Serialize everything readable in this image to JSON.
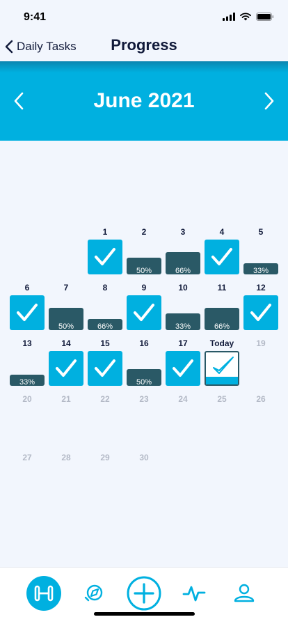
{
  "status": {
    "time": "9:41"
  },
  "nav": {
    "back_label": "Daily Tasks",
    "title": "Progress"
  },
  "month": {
    "title": "June 2021"
  },
  "colors": {
    "accent": "#00b0e0",
    "partial": "#2a5966",
    "future_text": "#b3b9c6",
    "background": "#f2f6fd"
  },
  "calendar": {
    "days": [
      {
        "label": "1",
        "state": "done"
      },
      {
        "label": "2",
        "state": "partial",
        "percent": "50%",
        "fraction": 0.5
      },
      {
        "label": "3",
        "state": "partial",
        "percent": "66%",
        "fraction": 0.66
      },
      {
        "label": "4",
        "state": "done"
      },
      {
        "label": "5",
        "state": "partial",
        "percent": "33%",
        "fraction": 0.33
      },
      {
        "label": "6",
        "state": "done"
      },
      {
        "label": "7",
        "state": "partial",
        "percent": "50%",
        "fraction": 0.66
      },
      {
        "label": "8",
        "state": "partial",
        "percent": "66%",
        "fraction": 0.33
      },
      {
        "label": "9",
        "state": "done"
      },
      {
        "label": "10",
        "state": "partial",
        "percent": "33%",
        "fraction": 0.5
      },
      {
        "label": "11",
        "state": "partial",
        "percent": "66%",
        "fraction": 0.66
      },
      {
        "label": "12",
        "state": "done"
      },
      {
        "label": "13",
        "state": "partial",
        "percent": "33%",
        "fraction": 0.33
      },
      {
        "label": "14",
        "state": "done"
      },
      {
        "label": "15",
        "state": "done"
      },
      {
        "label": "16",
        "state": "partial",
        "percent": "50%",
        "fraction": 0.5
      },
      {
        "label": "17",
        "state": "done"
      },
      {
        "label": "Today",
        "state": "today"
      },
      {
        "label": "19",
        "state": "future"
      },
      {
        "label": "20",
        "state": "future"
      },
      {
        "label": "21",
        "state": "future"
      },
      {
        "label": "22",
        "state": "future"
      },
      {
        "label": "23",
        "state": "future"
      },
      {
        "label": "24",
        "state": "future"
      },
      {
        "label": "25",
        "state": "future"
      },
      {
        "label": "26",
        "state": "future"
      },
      {
        "label": "27",
        "state": "future"
      },
      {
        "label": "28",
        "state": "future"
      },
      {
        "label": "29",
        "state": "future"
      },
      {
        "label": "30",
        "state": "future"
      }
    ]
  },
  "tabbar": {
    "items": [
      {
        "icon": "dumbbell-icon",
        "active": true
      },
      {
        "icon": "compass-icon",
        "active": false
      },
      {
        "icon": "add-circle-icon",
        "active": false
      },
      {
        "icon": "activity-pulse-icon",
        "active": false
      },
      {
        "icon": "profile-icon",
        "active": false
      }
    ]
  }
}
